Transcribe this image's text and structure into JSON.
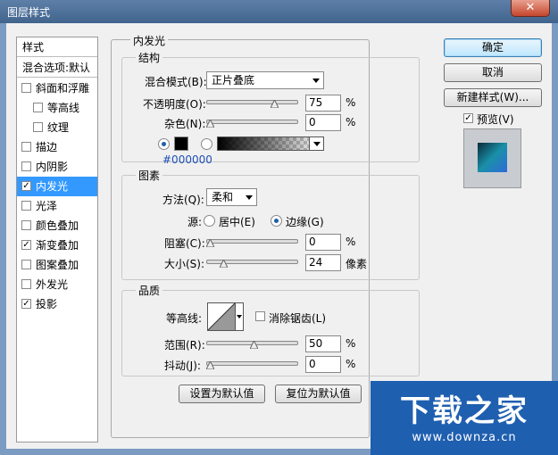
{
  "window": {
    "title": "图层样式",
    "close_glyph": "✕"
  },
  "styles_panel": {
    "header": "样式",
    "blend_default": "混合选项:默认",
    "items": [
      {
        "label": "斜面和浮雕",
        "checked": false,
        "indent": false
      },
      {
        "label": "等高线",
        "checked": false,
        "indent": true
      },
      {
        "label": "纹理",
        "checked": false,
        "indent": true
      },
      {
        "label": "描边",
        "checked": false,
        "indent": false
      },
      {
        "label": "内阴影",
        "checked": false,
        "indent": false
      },
      {
        "label": "内发光",
        "checked": true,
        "indent": false,
        "selected": true
      },
      {
        "label": "光泽",
        "checked": false,
        "indent": false
      },
      {
        "label": "颜色叠加",
        "checked": false,
        "indent": false
      },
      {
        "label": "渐变叠加",
        "checked": true,
        "indent": false
      },
      {
        "label": "图案叠加",
        "checked": false,
        "indent": false
      },
      {
        "label": "外发光",
        "checked": false,
        "indent": false
      },
      {
        "label": "投影",
        "checked": true,
        "indent": false
      }
    ]
  },
  "inner_glow": {
    "title": "内发光",
    "structure": {
      "title": "结构",
      "blend_mode_label": "混合模式(B):",
      "blend_mode_value": "正片叠底",
      "opacity_label": "不透明度(O):",
      "opacity_value": "75",
      "opacity_unit": "%",
      "noise_label": "杂色(N):",
      "noise_value": "0",
      "noise_unit": "%",
      "color_hex": "#000000"
    },
    "elements": {
      "title": "图素",
      "method_label": "方法(Q):",
      "method_value": "柔和",
      "source_label": "源:",
      "source_center": "居中(E)",
      "source_edge": "边缘(G)",
      "choke_label": "阻塞(C):",
      "choke_value": "0",
      "choke_unit": "%",
      "size_label": "大小(S):",
      "size_value": "24",
      "size_unit": "像素"
    },
    "quality": {
      "title": "品质",
      "contour_label": "等高线:",
      "antialias_label": "消除锯齿(L)",
      "range_label": "范围(R):",
      "range_value": "50",
      "range_unit": "%",
      "jitter_label": "抖动(J):",
      "jitter_value": "0",
      "jitter_unit": "%"
    },
    "make_default": "设置为默认值",
    "reset_default": "复位为默认值"
  },
  "buttons": {
    "ok": "确定",
    "cancel": "取消",
    "new_style": "新建样式(W)...",
    "preview": "预览(V)"
  },
  "watermark": {
    "text": "下载之家",
    "url": "www.downza.cn"
  }
}
